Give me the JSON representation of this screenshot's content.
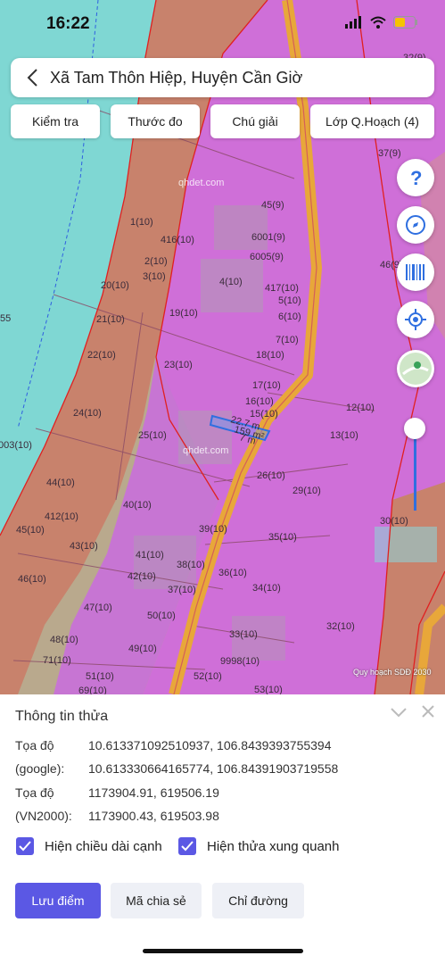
{
  "status": {
    "time": "16:22"
  },
  "header": {
    "title": "Xã Tam Thôn Hiệp, Huyện Cần Giờ"
  },
  "toolbar": {
    "check": "Kiểm tra",
    "measure": "Thước đo",
    "legend": "Chú giải",
    "layer": "Lớp Q.Hoạch (4)"
  },
  "map": {
    "attribution": "Quy hoạch SDĐ 2030",
    "watermarks": [
      "qhdet.com",
      "qhdet.com"
    ],
    "parcel": {
      "len1": "22.7 m",
      "area": "159 m²",
      "len2": "7 m"
    },
    "labels": [
      "32(9)",
      "37(9)",
      "46(9)",
      "45(9)",
      "1(10)",
      "416(10)",
      "6001(9)",
      "6005(9)",
      "2(10)",
      "3(10)",
      "20(10)",
      "4(10)",
      "417(10)",
      "5(10)",
      "6(10)",
      "19(10)",
      "21(10)",
      "7(10)",
      "22(10)",
      "18(10)",
      "23(10)",
      "17(10)",
      "16(10)",
      "15(10)",
      "12(10)",
      "24(10)",
      "25(10)",
      "13(10)",
      "003(10)",
      "26(10)",
      "29(10)",
      "44(10)",
      "40(10)",
      "30(10)",
      "412(10)",
      "39(10)",
      "45(10)",
      "35(10)",
      "43(10)",
      "41(10)",
      "38(10)",
      "42(10)",
      "36(10)",
      "46(10)",
      "37(10)",
      "34(10)",
      "47(10)",
      "50(10)",
      "48(10)",
      "33(10)",
      "49(10)",
      "32(10)",
      "71(10)",
      "9998(10)",
      "51(10)",
      "52(10)",
      "69(10)",
      "53(10)",
      "55"
    ]
  },
  "fabs": [
    "help-icon",
    "compass-icon",
    "barcode-icon",
    "locate-icon",
    "layers-icon"
  ],
  "info": {
    "title": "Thông tin thửa",
    "rows": [
      {
        "k": "Tọa độ",
        "v": "10.613371092510937, 106.8439393755394"
      },
      {
        "k": "(google):",
        "v": "10.613330664165774, 106.84391903719558"
      },
      {
        "k": "Tọa độ",
        "v": "1173904.91, 619506.19"
      },
      {
        "k": "(VN2000):",
        "v": "1173900.43, 619503.98"
      }
    ],
    "check_edges": "Hiện chiều dài cạnh",
    "check_neighbors": "Hiện thửa xung quanh",
    "save": "Lưu điểm",
    "share": "Mã chia sẻ",
    "directions": "Chỉ đường"
  },
  "colors": {
    "water": "#7fd7d3",
    "agri": "#c8826c",
    "residential": "#cf6fd8",
    "road": "#e8a73a",
    "accent": "#5b58e4"
  }
}
